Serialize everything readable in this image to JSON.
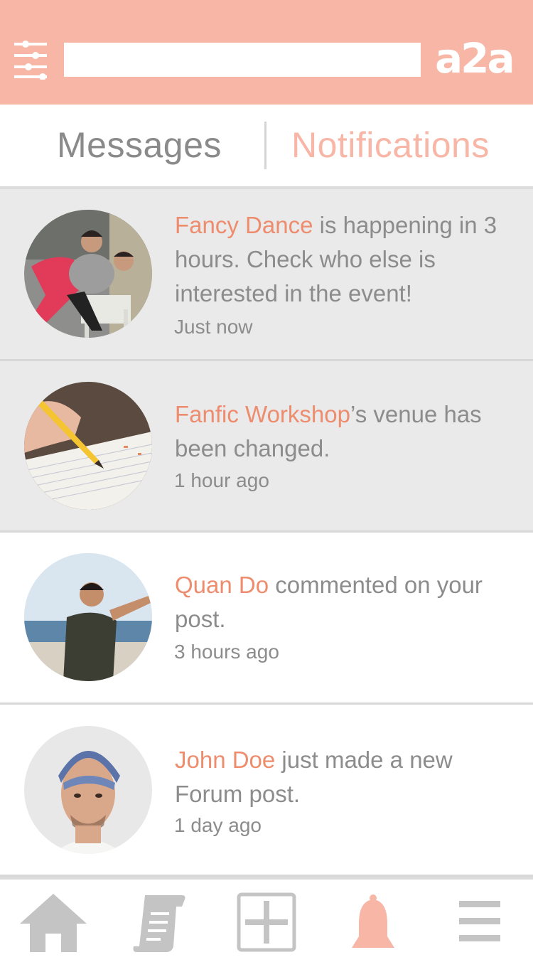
{
  "header": {
    "search_placeholder": "",
    "logo": "a2a",
    "icons": {
      "filter": "sliders-icon",
      "search": "search-input"
    }
  },
  "tabs": {
    "messages": "Messages",
    "notifications": "Notifications",
    "active": "notifications"
  },
  "notifications": [
    {
      "who": "Fancy Dance",
      "text": " is happening in 3 hours. Check who else is interested in the event!",
      "time": "Just now",
      "unread": true,
      "avatar": "dancers-photo"
    },
    {
      "who": "Fanfic Workshop",
      "text": "’s venue has been changed.",
      "time": "1 hour ago",
      "unread": true,
      "avatar": "pencil-writing-photo"
    },
    {
      "who": "Quan Do",
      "text": " commented on your post.",
      "time": "3 hours ago",
      "unread": false,
      "avatar": "man-at-beach-photo"
    },
    {
      "who": "John Doe",
      "text": " just made a new Forum post.",
      "time": "1 day ago",
      "unread": false,
      "avatar": "man-in-cap-photo"
    }
  ],
  "nav": {
    "items": [
      "home-icon",
      "scroll-icon",
      "add-square-icon",
      "bell-icon",
      "menu-icon"
    ],
    "active": "bell-icon"
  },
  "colors": {
    "brand": "#f7b6a6",
    "highlight": "#ee8c6e",
    "text": "#8c8c8c",
    "unread_bg": "#eaeaea",
    "icon_gray": "#c4c4c4"
  }
}
